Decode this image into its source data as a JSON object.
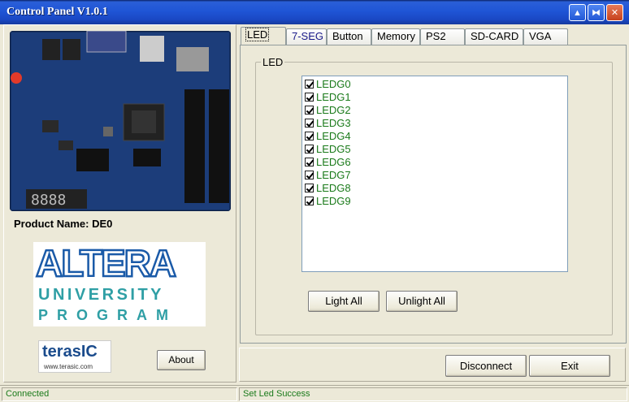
{
  "window": {
    "title": "Control Panel V1.0.1",
    "controls": [
      "minimize-icon",
      "maximize-icon",
      "close-icon"
    ]
  },
  "left": {
    "product_label": "Product Name: DE0",
    "altera_logo": {
      "main": "ALTERA",
      "line2": "UNIVERSITY",
      "line3": "PROGRAM"
    },
    "terasic_logo": {
      "main": "terasIC",
      "sub": "www.terasic.com"
    },
    "about_label": "About"
  },
  "tabs": [
    {
      "label": "LED",
      "active": true
    },
    {
      "label": "7-SEG",
      "active": false
    },
    {
      "label": "Button",
      "active": false
    },
    {
      "label": "Memory",
      "active": false
    },
    {
      "label": "PS2",
      "active": false
    },
    {
      "label": "SD-CARD",
      "active": false
    },
    {
      "label": "VGA",
      "active": false
    }
  ],
  "led": {
    "group_label": "LED",
    "items": [
      {
        "label": "LEDG0",
        "checked": true
      },
      {
        "label": "LEDG1",
        "checked": true
      },
      {
        "label": "LEDG2",
        "checked": true
      },
      {
        "label": "LEDG3",
        "checked": true
      },
      {
        "label": "LEDG4",
        "checked": true
      },
      {
        "label": "LEDG5",
        "checked": true
      },
      {
        "label": "LEDG6",
        "checked": true
      },
      {
        "label": "LEDG7",
        "checked": true
      },
      {
        "label": "LEDG8",
        "checked": true
      },
      {
        "label": "LEDG9",
        "checked": true
      }
    ],
    "light_all_label": "Light All",
    "unlight_all_label": "Unlight All"
  },
  "bottom": {
    "disconnect_label": "Disconnect",
    "exit_label": "Exit"
  },
  "status": {
    "left": "Connected",
    "right": "Set Led Success"
  },
  "colors": {
    "titlebar": "#1f55d6",
    "status_text": "#1a7a1a",
    "led_text": "#1a7a1a",
    "face": "#ece9d8"
  }
}
